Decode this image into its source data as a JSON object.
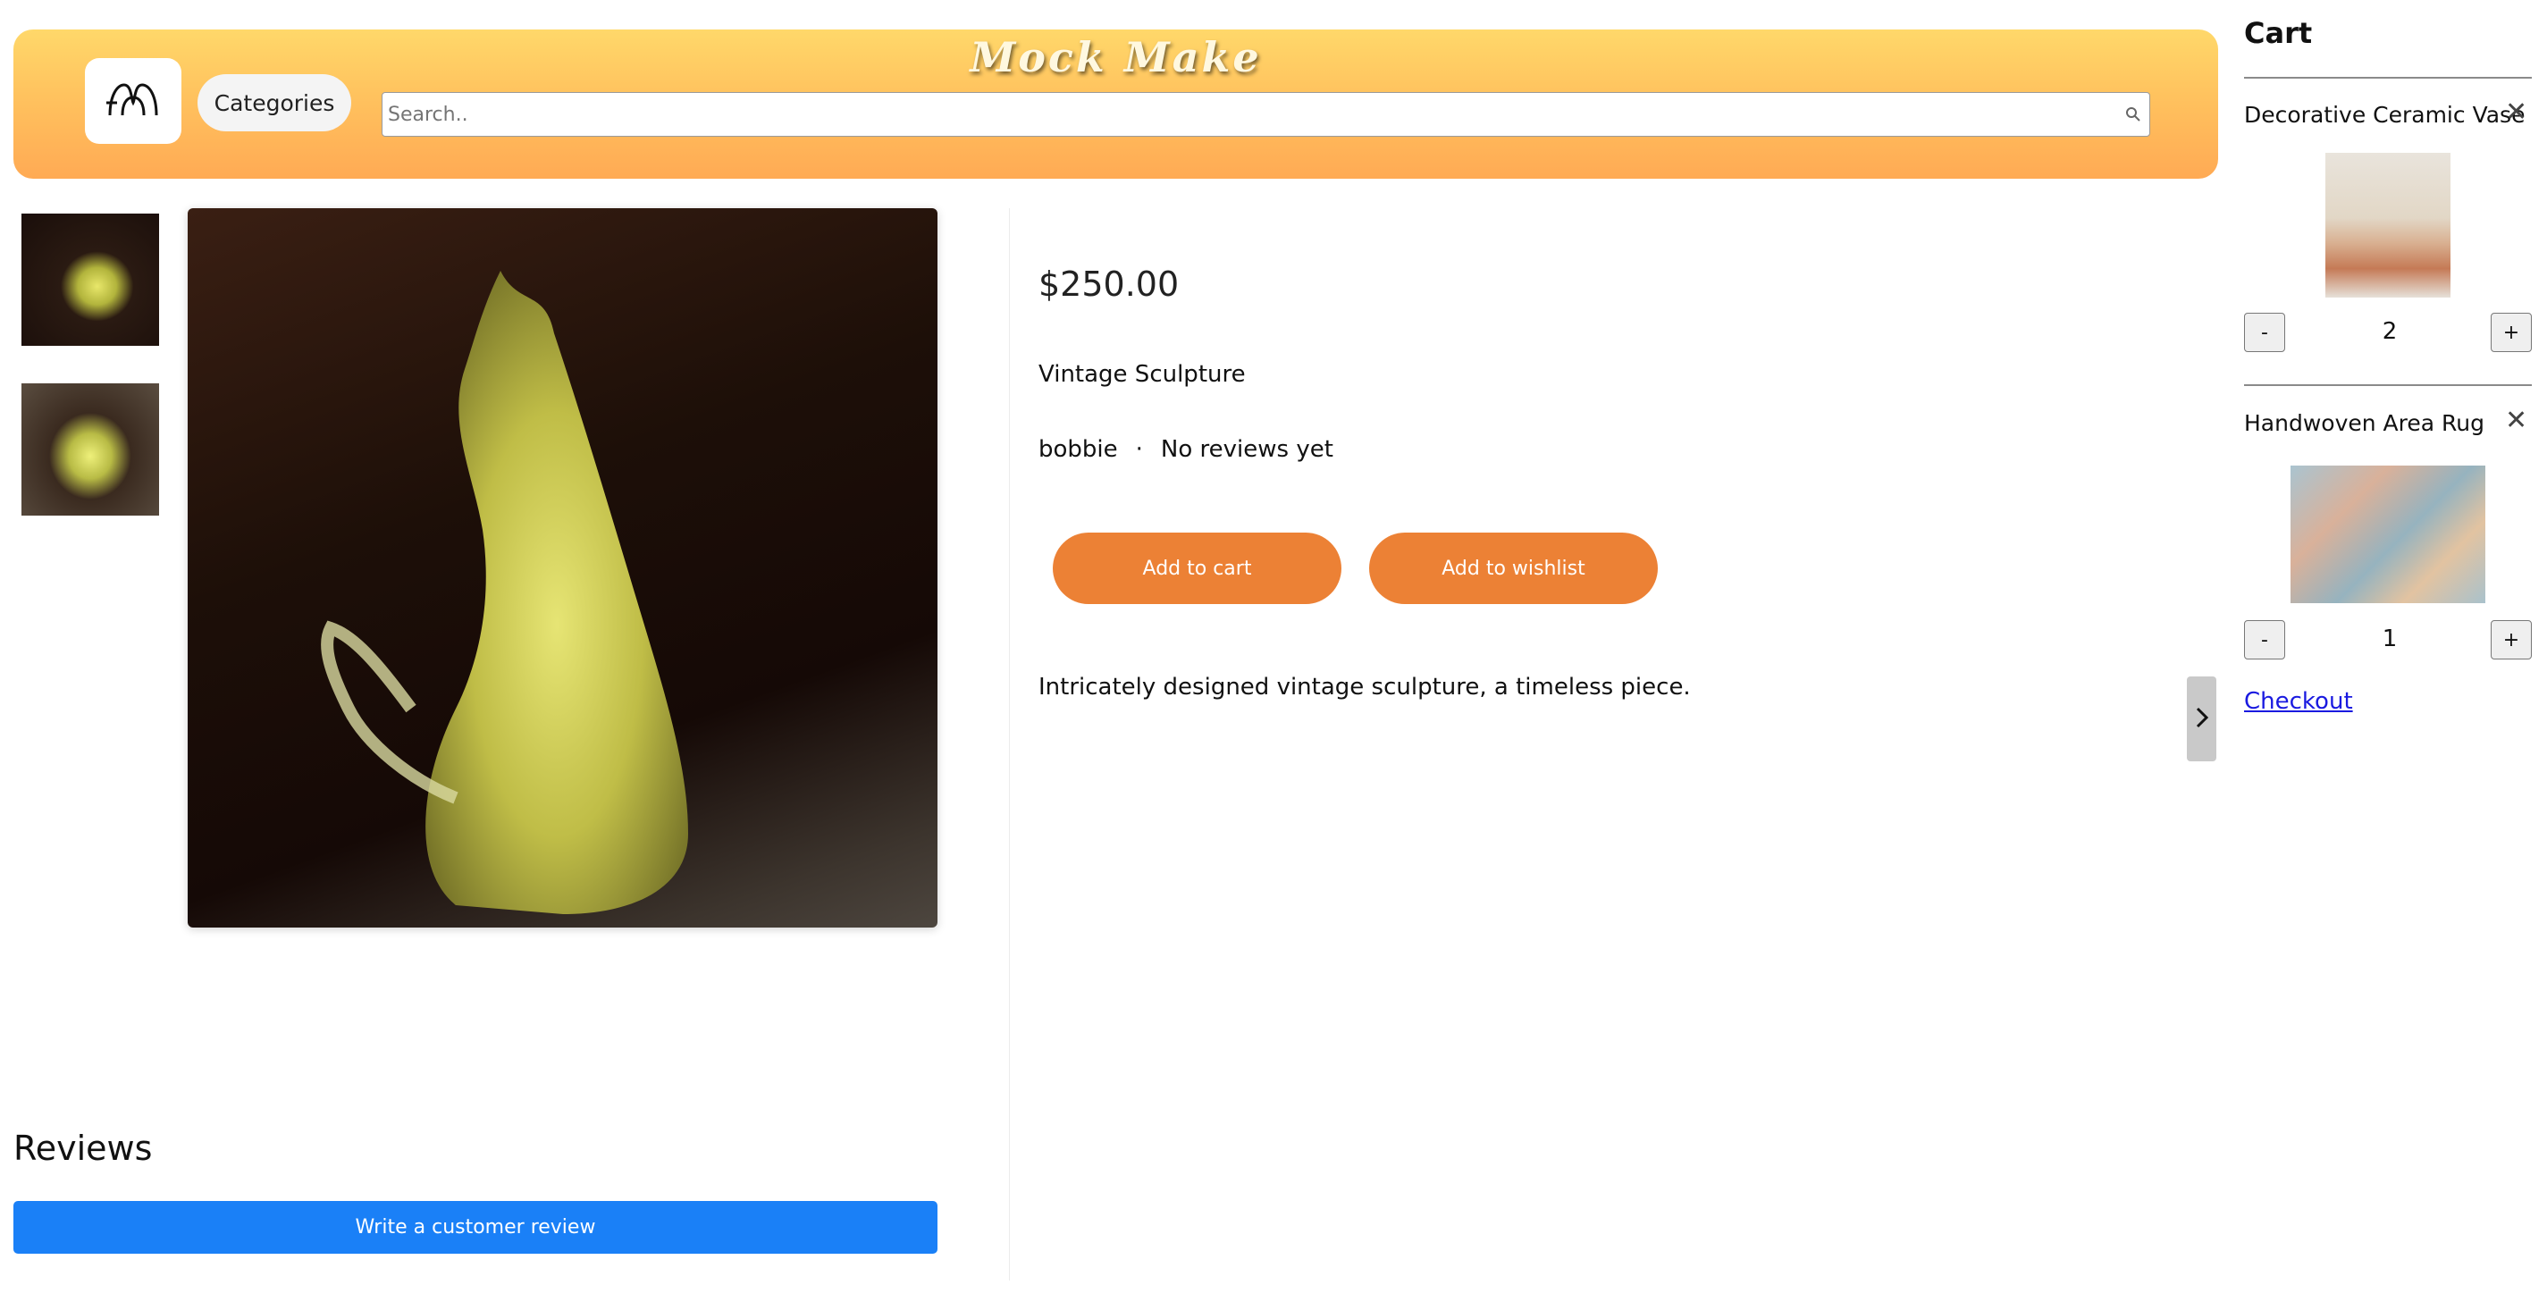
{
  "header": {
    "brand": "Mock Make",
    "categories_label": "Categories",
    "search_placeholder": "Search..",
    "search_value": ""
  },
  "icons": {
    "logo": "brand-logo-icon",
    "search": "search-icon",
    "close": "close-icon",
    "chevron": "chevron-right-icon"
  },
  "product": {
    "price": "$250.00",
    "title": "Vintage Sculpture",
    "seller": "bobbie",
    "separator": "·",
    "reviews_status": "No reviews yet",
    "add_to_cart_label": "Add to cart",
    "add_to_wishlist_label": "Add to wishlist",
    "description": "Intricately designed vintage sculpture, a timeless piece."
  },
  "reviews": {
    "heading": "Reviews",
    "write_review_label": "Write a customer review"
  },
  "cart": {
    "title": "Cart",
    "items": [
      {
        "name": "Decorative Ceramic Vase",
        "quantity": "2",
        "minus_label": "-",
        "plus_label": "+"
      },
      {
        "name": "Handwoven Area Rug",
        "quantity": "1",
        "minus_label": "-",
        "plus_label": "+"
      }
    ],
    "checkout_label": "Checkout"
  },
  "colors": {
    "header_gradient_top": "#ffd86a",
    "header_gradient_bottom": "#ffaa54",
    "accent_orange": "#ec8135",
    "primary_blue": "#1a80f7",
    "link_blue": "#1a1ae0"
  }
}
